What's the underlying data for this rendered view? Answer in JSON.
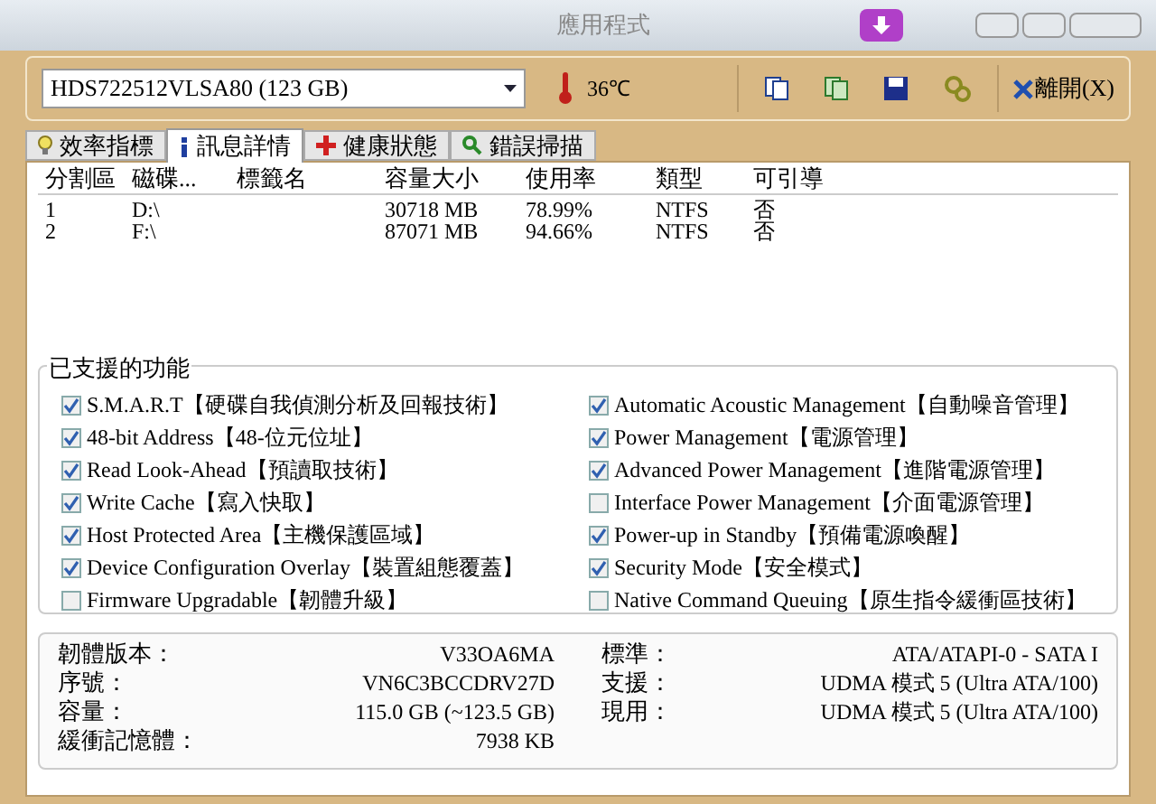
{
  "window": {
    "title": "應用程式"
  },
  "toolbar": {
    "drive": "HDS722512VLSA80 (123 GB)",
    "temperature": "36℃",
    "exit": "離開(X)"
  },
  "tabs": [
    {
      "label": "效率指標",
      "selected": false,
      "kind": "bulb"
    },
    {
      "label": "訊息詳情",
      "selected": true,
      "kind": "info"
    },
    {
      "label": "健康狀態",
      "selected": false,
      "kind": "cross"
    },
    {
      "label": "錯誤掃描",
      "selected": false,
      "kind": "magnifier"
    }
  ],
  "partitions": {
    "columns": [
      "分割區",
      "磁碟...",
      "標籤名",
      "容量大小",
      "使用率",
      "類型",
      "可引導"
    ],
    "rows": [
      [
        "1",
        "D:\\",
        "",
        "30718 MB",
        "78.99%",
        "NTFS",
        "否"
      ],
      [
        "2",
        "F:\\",
        "",
        "87071 MB",
        "94.66%",
        "NTFS",
        "否"
      ]
    ]
  },
  "features": {
    "title": "已支援的功能",
    "left": [
      {
        "label": "S.M.A.R.T【硬碟自我偵測分析及回報技術】",
        "checked": true
      },
      {
        "label": "48-bit Address【48-位元位址】",
        "checked": true
      },
      {
        "label": "Read Look-Ahead【預讀取技術】",
        "checked": true
      },
      {
        "label": "Write Cache【寫入快取】",
        "checked": true
      },
      {
        "label": "Host Protected Area【主機保護區域】",
        "checked": true
      },
      {
        "label": "Device Configuration Overlay【裝置組態覆蓋】",
        "checked": true
      },
      {
        "label": "Firmware Upgradable【韌體升級】",
        "checked": false
      }
    ],
    "right": [
      {
        "label": "Automatic Acoustic Management【自動噪音管理】",
        "checked": true
      },
      {
        "label": "Power Management【電源管理】",
        "checked": true
      },
      {
        "label": "Advanced Power Management【進階電源管理】",
        "checked": true
      },
      {
        "label": "Interface Power Management【介面電源管理】",
        "checked": false
      },
      {
        "label": "Power-up in Standby【預備電源喚醒】",
        "checked": true
      },
      {
        "label": "Security Mode【安全模式】",
        "checked": true
      },
      {
        "label": "Native Command Queuing【原生指令緩衝區技術】",
        "checked": false
      }
    ]
  },
  "info": {
    "left": [
      {
        "label": "韌體版本：",
        "value": "V33OA6MA"
      },
      {
        "label": "序號：",
        "value": "VN6C3BCCDRV27D"
      },
      {
        "label": "容量：",
        "value": "115.0 GB (~123.5 GB)"
      },
      {
        "label": "緩衝記憶體：",
        "value": "7938 KB"
      }
    ],
    "right": [
      {
        "label": "標準：",
        "value": "ATA/ATAPI-0 - SATA I"
      },
      {
        "label": "支援：",
        "value": "UDMA 模式 5 (Ultra ATA/100)"
      },
      {
        "label": "現用：",
        "value": "UDMA 模式 5 (Ultra ATA/100)"
      }
    ]
  }
}
